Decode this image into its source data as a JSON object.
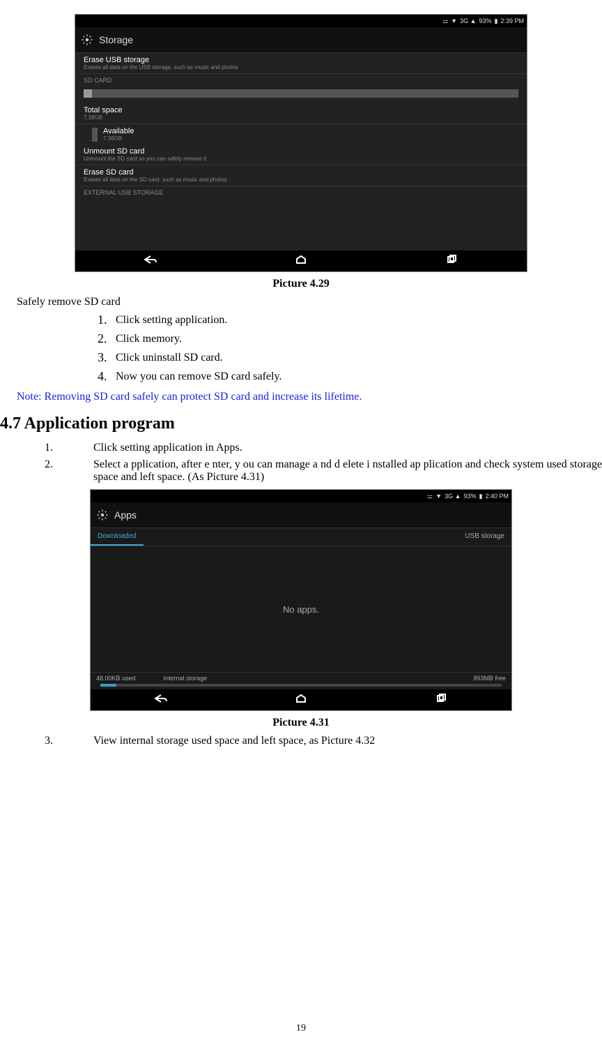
{
  "screenshot1": {
    "statusbar": {
      "bt": "⚍",
      "wifi": "▼",
      "sig": "3G ▲",
      "battery_pct": "93%",
      "battery_icon": "▮",
      "time": "2:39 PM"
    },
    "header": "Storage",
    "erase_usb": {
      "title": "Erase USB storage",
      "sub": "Erases all data on the USB storage, such as music and photos"
    },
    "sd_label": "SD CARD",
    "total": {
      "title": "Total space",
      "value": "7.39GB"
    },
    "available": {
      "title": "Available",
      "value": "7.36GB"
    },
    "unmount": {
      "title": "Unmount SD card",
      "sub": "Unmount the SD card so you can safely remove it"
    },
    "erase_sd": {
      "title": "Erase SD card",
      "sub": "Erases all data on the SD card, such as music and photos"
    },
    "ext_label": "EXTERNAL USB STORAGE"
  },
  "caption1": "Picture 4.29",
  "safely_remove": "Safely remove SD card",
  "steps1": [
    "Click setting application.",
    "Click memory.",
    "Click uninstall SD card.",
    "Now you can remove SD card safely."
  ],
  "note": "Note: Removing SD card safely can protect SD card and increase its lifetime.",
  "section_heading": "4.7 Application program",
  "steps2": [
    "Click setting application in Apps.",
    "Select a pplication,  after e nter, y ou  can  manage a nd d elete i nstalled ap plication and check system used storage space and left space. (As Picture 4.31)"
  ],
  "screenshot2": {
    "statusbar": {
      "bt": "⚍",
      "wifi": "▼",
      "sig": "3G ▲",
      "battery_pct": "93%",
      "battery_icon": "▮",
      "time": "2:40 PM"
    },
    "header": "Apps",
    "tab_active": "Downloaded",
    "tab_right": "USB storage",
    "no_apps": "No apps.",
    "footer_left": "48.00KB used",
    "footer_center": "Internal storage",
    "footer_right": "893MB free"
  },
  "caption2": "Picture 4.31",
  "step3": "View internal storage used space and left space, as Picture 4.32",
  "page_number": "19"
}
